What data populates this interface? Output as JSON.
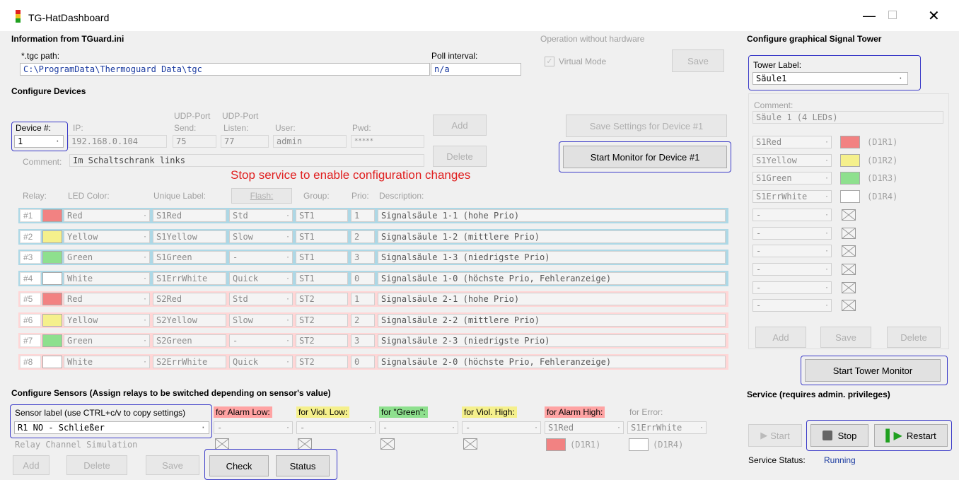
{
  "window": {
    "title": "TG-HatDashboard"
  },
  "info": {
    "title": "Information from TGuard.ini",
    "tgc_label": "*.tgc path:",
    "tgc_value": "C:\\ProgramData\\Thermoguard Data\\tgc",
    "poll_label": "Poll interval:",
    "poll_value": "n/a"
  },
  "op": {
    "title": "Operation without hardware",
    "virtual": "Virtual Mode",
    "save": "Save"
  },
  "tower": {
    "title": "Configure graphical Signal Tower",
    "label": "Tower Label:",
    "value": "Säule1",
    "comment_label": "Comment:",
    "comment_value": "Säule 1 (4 LEDs)",
    "rows": [
      {
        "name": "S1Red",
        "color": "#f28282",
        "code": "(D1R1)"
      },
      {
        "name": "S1Yellow",
        "color": "#f5f08c",
        "code": "(D1R2)"
      },
      {
        "name": "S1Green",
        "color": "#8ee08e",
        "code": "(D1R3)"
      },
      {
        "name": "S1ErrWhite",
        "color": "#ffffff",
        "code": "(D1R4)"
      },
      {
        "name": "-",
        "color": "",
        "code": ""
      },
      {
        "name": "-",
        "color": "",
        "code": ""
      },
      {
        "name": "-",
        "color": "",
        "code": ""
      },
      {
        "name": "-",
        "color": "",
        "code": ""
      },
      {
        "name": "-",
        "color": "",
        "code": ""
      },
      {
        "name": "-",
        "color": "",
        "code": ""
      }
    ],
    "add": "Add",
    "save": "Save",
    "delete": "Delete",
    "monitor": "Start Tower Monitor"
  },
  "devices": {
    "title": "Configure Devices",
    "device_label": "Device #:",
    "device_value": "1",
    "ip_label": "IP:",
    "ip_value": "192.168.0.104",
    "udp_send_label1": "UDP-Port",
    "udp_send_label2": "Send:",
    "udp_send_value": "75",
    "udp_listen_label1": "UDP-Port",
    "udp_listen_label2": "Listen:",
    "udp_listen_value": "77",
    "user_label": "User:",
    "user_value": "admin",
    "pwd_label": "Pwd:",
    "pwd_value": "*****",
    "add": "Add",
    "delete": "Delete",
    "save_settings": "Save Settings for Device #1",
    "start_monitor": "Start Monitor for Device #1",
    "comment_label": "Comment:",
    "comment_value": "Im Schaltschrank links",
    "warning": "Stop service to enable configuration changes"
  },
  "relay_headers": {
    "relay": "Relay:",
    "led": "LED Color:",
    "unique": "Unique Label:",
    "flash": "Flash:",
    "group": "Group:",
    "prio": "Prio:",
    "desc": "Description:"
  },
  "relays": [
    {
      "num": "#1",
      "color": "#f28282",
      "led": "Red",
      "label": "S1Red",
      "flash": "Std",
      "group": "ST1",
      "prio": "1",
      "desc": "Signalsäule 1-1 (hohe Prio)",
      "bg": "#add8e6"
    },
    {
      "num": "#2",
      "color": "#f5f08c",
      "led": "Yellow",
      "label": "S1Yellow",
      "flash": "Slow",
      "group": "ST1",
      "prio": "2",
      "desc": "Signalsäule 1-2 (mittlere Prio)",
      "bg": "#add8e6"
    },
    {
      "num": "#3",
      "color": "#8ee08e",
      "led": "Green",
      "label": "S1Green",
      "flash": "-",
      "group": "ST1",
      "prio": "3",
      "desc": "Signalsäule 1-3 (niedrigste Prio)",
      "bg": "#add8e6"
    },
    {
      "num": "#4",
      "color": "#ffffff",
      "led": "White",
      "label": "S1ErrWhite",
      "flash": "Quick",
      "group": "ST1",
      "prio": "0",
      "desc": "Signalsäule 1-0 (höchste Prio, Fehleranzeige)",
      "bg": "#add8e6"
    },
    {
      "num": "#5",
      "color": "#f28282",
      "led": "Red",
      "label": "S2Red",
      "flash": "Std",
      "group": "ST2",
      "prio": "1",
      "desc": "Signalsäule 2-1 (hohe Prio)",
      "bg": "#ffd6d6"
    },
    {
      "num": "#6",
      "color": "#f5f08c",
      "led": "Yellow",
      "label": "S2Yellow",
      "flash": "Slow",
      "group": "ST2",
      "prio": "2",
      "desc": "Signalsäule 2-2 (mittlere Prio)",
      "bg": "#ffd6d6"
    },
    {
      "num": "#7",
      "color": "#8ee08e",
      "led": "Green",
      "label": "S2Green",
      "flash": "-",
      "group": "ST2",
      "prio": "3",
      "desc": "Signalsäule 2-3 (niedrigste Prio)",
      "bg": "#ffd6d6"
    },
    {
      "num": "#8",
      "color": "#ffffff",
      "led": "White",
      "label": "S2ErrWhite",
      "flash": "Quick",
      "group": "ST2",
      "prio": "0",
      "desc": "Signalsäule 2-0 (höchste Prio, Fehleranzeige)",
      "bg": "#ffd6d6"
    }
  ],
  "sensors": {
    "title": "Configure Sensors (Assign relays to be switched depending on sensor's value)",
    "label": "Sensor label (use CTRL+c/v to copy settings)",
    "value": "R1 NO - Schließer",
    "sim": "Relay Channel Simulation",
    "cols": [
      {
        "head": "for Alarm Low:",
        "bg": "#ffa3a3",
        "val": "-",
        "swatch": "",
        "code": ""
      },
      {
        "head": "for Viol. Low:",
        "bg": "#f5f08c",
        "val": "-",
        "swatch": "",
        "code": ""
      },
      {
        "head": "for \"Green\":",
        "bg": "#8ee08e",
        "val": "-",
        "swatch": "",
        "code": ""
      },
      {
        "head": "for Viol. High:",
        "bg": "#f5f08c",
        "val": "-",
        "swatch": "",
        "code": ""
      },
      {
        "head": "for Alarm High:",
        "bg": "#ffa3a3",
        "val": "S1Red",
        "swatch": "#f28282",
        "code": "(D1R1)"
      },
      {
        "head": "for Error:",
        "bg": "",
        "val": "S1ErrWhite",
        "swatch": "#ffffff",
        "code": "(D1R4)"
      }
    ],
    "add": "Add",
    "delete": "Delete",
    "save": "Save",
    "check": "Check",
    "status": "Status"
  },
  "service": {
    "title": "Service (requires admin. privileges)",
    "start": "Start",
    "stop": "Stop",
    "restart": "Restart",
    "status_label": "Service Status:",
    "status_value": "Running"
  },
  "colors": {
    "accent": "#3a3ac8",
    "warning": "#e02020",
    "status": "#1a3aa0"
  }
}
